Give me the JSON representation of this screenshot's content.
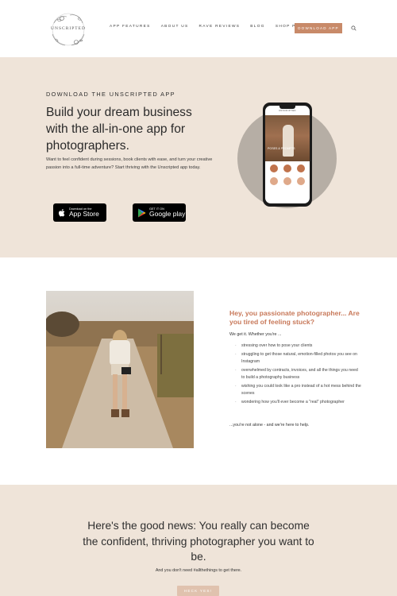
{
  "header": {
    "logo_text": "UNSCRIPTED",
    "nav": [
      "APP FEATURES",
      "ABOUT US",
      "RAVE REVIEWS",
      "BLOG",
      "SHOP PRESETS"
    ],
    "cta_label": "DOWNLOAD APP",
    "search_icon": "search-icon"
  },
  "hero": {
    "eyebrow": "DOWNLOAD THE UNSCRIPTED APP",
    "title": "Build your dream business with the all-in-one app for photographers.",
    "subtitle": "Want to feel confident during sessions, book clients with ease, and turn your creative passion into a full-time adventure? Start thriving with the Unscripted app today.",
    "app_store": {
      "small": "Download on the",
      "big": "App Store"
    },
    "google_play": {
      "small": "GET IT ON",
      "big": "Google play"
    },
    "phone": {
      "app_title": "UNSCRIPTED",
      "photo_label": "POSES & PROMPTS"
    }
  },
  "section2": {
    "title": "Hey, you passionate photographer... Are you tired of feeling stuck?",
    "intro": "We get it. Whether you're ...",
    "items": [
      "stressing over how to pose your clients",
      "struggling to get those natural, emotion-filled photos you see on Instagram",
      "overwhelmed by contracts, invoices, and all the things you need to build a photography business",
      "wishing you could look like a pro instead of a hot mess behind the scenes",
      "wondering how you'll ever become a \"real\" photographer"
    ],
    "outro": "...you're not alone - and we're here to help."
  },
  "section3": {
    "title": "Here's the good news: You really can become the confident, thriving photographer you want to be.",
    "subtitle": "And you don't need #allthethings to get there.",
    "button": "HECK YES!"
  },
  "colors": {
    "accent": "#c88a69",
    "beige": "#efe4d9",
    "heading_accent": "#c8795a"
  }
}
